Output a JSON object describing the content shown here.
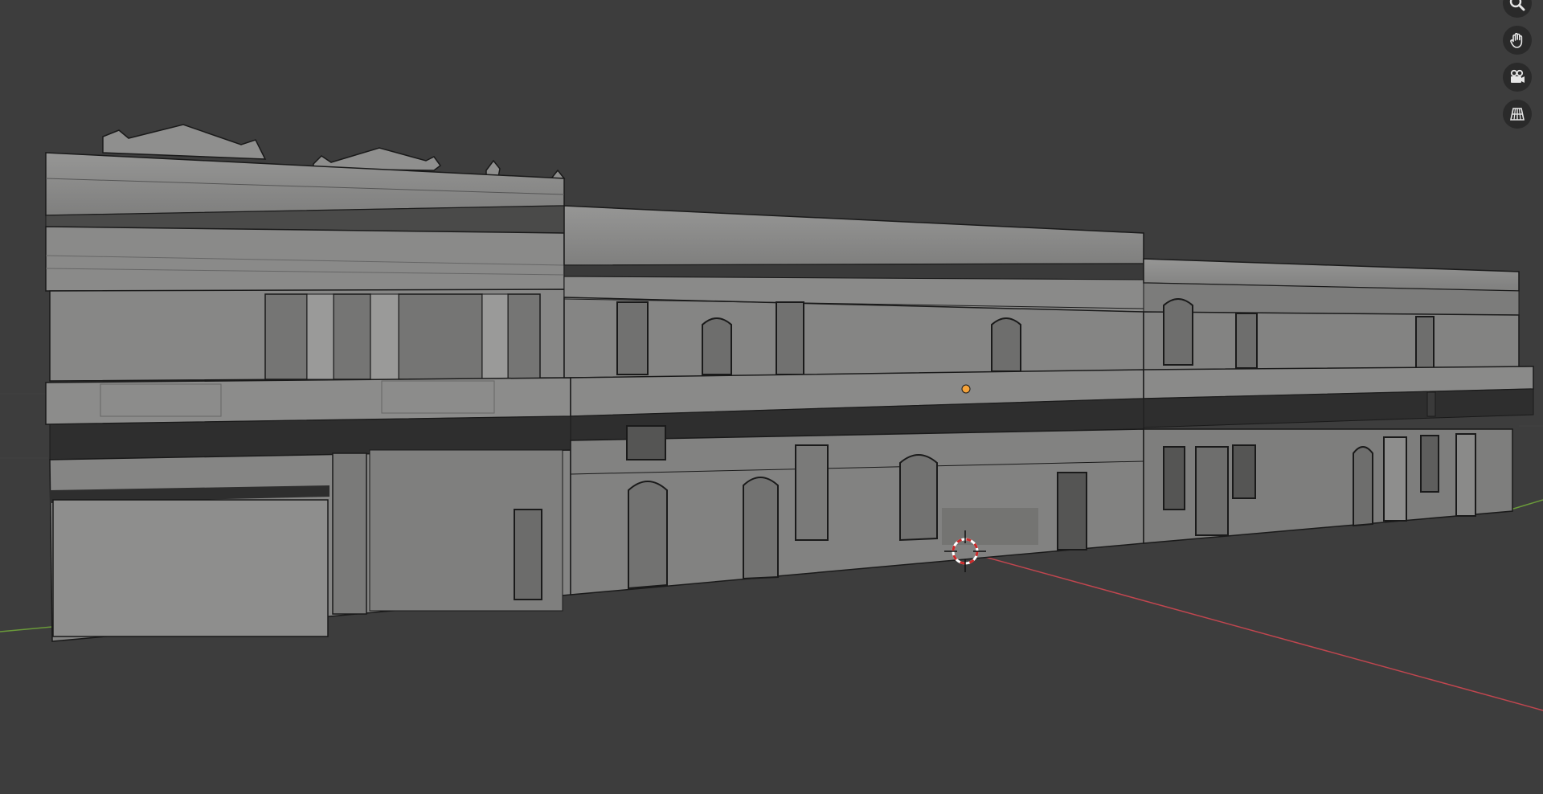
{
  "viewport": {
    "background_color": "#3d3d3d",
    "grid_line_color": "#464646",
    "x_axis_color": "#c0464f",
    "y_axis_color": "#6a9a3a",
    "origin_color": "#f5a33a",
    "cursor_color": "#cc2a2a"
  },
  "facade": {
    "wall_light": "#8d8d8c",
    "wall_mid": "#7a7a79",
    "wall_dark": "#5b5b5a",
    "band_dark": "#2b2b2b",
    "outline": "#1a1a1a"
  },
  "navigation": [
    {
      "name": "zoom",
      "icon": "magnifier-icon"
    },
    {
      "name": "pan",
      "icon": "hand-icon"
    },
    {
      "name": "camera",
      "icon": "camera-icon"
    },
    {
      "name": "perspective",
      "icon": "grid-perspective-icon"
    }
  ]
}
